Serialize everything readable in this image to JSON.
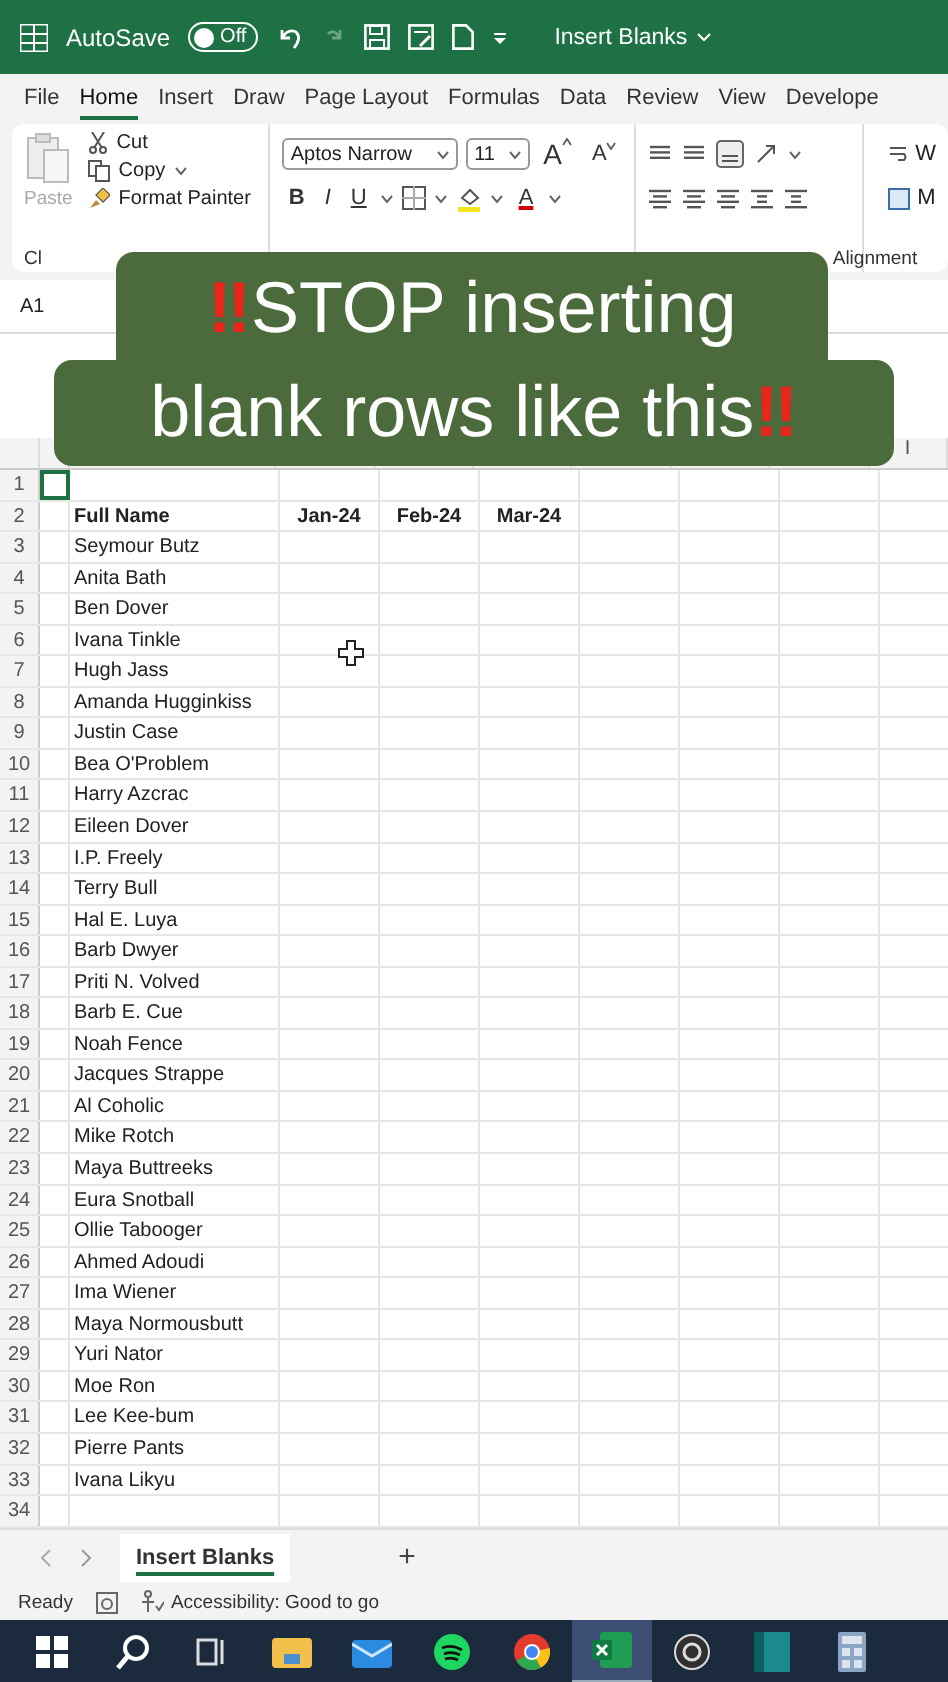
{
  "title_bar": {
    "autosave_label": "AutoSave",
    "autosave": {
      "label": "Off",
      "on": false
    },
    "document_title": "Insert Blanks"
  },
  "menu_tabs": [
    {
      "label": "File",
      "selected": false
    },
    {
      "label": "Home",
      "selected": true
    },
    {
      "label": "Insert",
      "selected": false
    },
    {
      "label": "Draw",
      "selected": false
    },
    {
      "label": "Page Layout",
      "selected": false
    },
    {
      "label": "Formulas",
      "selected": false
    },
    {
      "label": "Data",
      "selected": false
    },
    {
      "label": "Review",
      "selected": false
    },
    {
      "label": "View",
      "selected": false
    },
    {
      "label": "Develope",
      "selected": false
    }
  ],
  "ribbon": {
    "clipboard": {
      "paste": "Paste",
      "cut": "Cut",
      "copy": "Copy",
      "format_painter": "Format Painter",
      "group_label": "Cl"
    },
    "font": {
      "name": "Aptos Narrow",
      "size": "11",
      "grow": "A",
      "shrink": "A",
      "bold": "B",
      "italic": "I",
      "underline": "U",
      "font_color": "A"
    },
    "alignment": {
      "group_label": "Alignment"
    },
    "wrap_label": "W",
    "merge_label": "M"
  },
  "name_box": "A1",
  "caption": {
    "lines": [
      [
        {
          "kind": "mark",
          "text": "‼"
        },
        {
          "kind": "text",
          "text": "STOP inserting"
        }
      ],
      [
        {
          "kind": "text",
          "text": "blank rows like this"
        },
        {
          "kind": "mark",
          "text": "‼"
        }
      ]
    ]
  },
  "visible_column_header": "I",
  "rows": [
    {
      "number": "1",
      "kind": "empty",
      "selected": true
    },
    {
      "number": "2",
      "kind": "header",
      "cells": [
        "Full Name",
        "Jan-24",
        "Feb-24",
        "Mar-24"
      ],
      "selected": false
    },
    {
      "number": "3",
      "kind": "data",
      "cells": [
        "Seymour Butz"
      ],
      "selected": false
    },
    {
      "number": "4",
      "kind": "data",
      "cells": [
        "Anita Bath"
      ],
      "selected": false
    },
    {
      "number": "5",
      "kind": "data",
      "cells": [
        "Ben Dover"
      ],
      "selected": false
    },
    {
      "number": "6",
      "kind": "data",
      "cells": [
        "Ivana Tinkle"
      ],
      "selected": false
    },
    {
      "number": "7",
      "kind": "data",
      "cells": [
        "Hugh Jass"
      ],
      "selected": false
    },
    {
      "number": "8",
      "kind": "data",
      "cells": [
        "Amanda Hugginkiss"
      ],
      "selected": false
    },
    {
      "number": "9",
      "kind": "data",
      "cells": [
        "Justin Case"
      ],
      "selected": false
    },
    {
      "number": "10",
      "kind": "data",
      "cells": [
        "Bea O'Problem"
      ],
      "selected": false
    },
    {
      "number": "11",
      "kind": "data",
      "cells": [
        "Harry Azcrac"
      ],
      "selected": false
    },
    {
      "number": "12",
      "kind": "data",
      "cells": [
        "Eileen Dover"
      ],
      "selected": false
    },
    {
      "number": "13",
      "kind": "data",
      "cells": [
        "I.P. Freely"
      ],
      "selected": false
    },
    {
      "number": "14",
      "kind": "data",
      "cells": [
        "Terry Bull"
      ],
      "selected": false
    },
    {
      "number": "15",
      "kind": "data",
      "cells": [
        "Hal E. Luya"
      ],
      "selected": false
    },
    {
      "number": "16",
      "kind": "data",
      "cells": [
        "Barb Dwyer"
      ],
      "selected": false
    },
    {
      "number": "17",
      "kind": "data",
      "cells": [
        "Priti N. Volved"
      ],
      "selected": false
    },
    {
      "number": "18",
      "kind": "data",
      "cells": [
        "Barb E. Cue"
      ],
      "selected": false
    },
    {
      "number": "19",
      "kind": "data",
      "cells": [
        "Noah Fence"
      ],
      "selected": false
    },
    {
      "number": "20",
      "kind": "data",
      "cells": [
        "Jacques Strappe"
      ],
      "selected": false
    },
    {
      "number": "21",
      "kind": "data",
      "cells": [
        "Al Coholic"
      ],
      "selected": false
    },
    {
      "number": "22",
      "kind": "data",
      "cells": [
        "Mike Rotch"
      ],
      "selected": false
    },
    {
      "number": "23",
      "kind": "data",
      "cells": [
        "Maya Buttreeks"
      ],
      "selected": false
    },
    {
      "number": "24",
      "kind": "data",
      "cells": [
        "Eura Snotball"
      ],
      "selected": false
    },
    {
      "number": "25",
      "kind": "data",
      "cells": [
        "Ollie Tabooger"
      ],
      "selected": false
    },
    {
      "number": "26",
      "kind": "data",
      "cells": [
        "Ahmed Adoudi"
      ],
      "selected": false
    },
    {
      "number": "27",
      "kind": "data",
      "cells": [
        "Ima Wiener"
      ],
      "selected": false
    },
    {
      "number": "28",
      "kind": "data",
      "cells": [
        "Maya Normousbutt"
      ],
      "selected": false
    },
    {
      "number": "29",
      "kind": "data",
      "cells": [
        "Yuri Nator"
      ],
      "selected": false
    },
    {
      "number": "30",
      "kind": "data",
      "cells": [
        "Moe Ron"
      ],
      "selected": false
    },
    {
      "number": "31",
      "kind": "data",
      "cells": [
        "Lee Kee-bum"
      ],
      "selected": false
    },
    {
      "number": "32",
      "kind": "data",
      "cells": [
        "Pierre Pants"
      ],
      "selected": false
    },
    {
      "number": "33",
      "kind": "data",
      "cells": [
        "Ivana Likyu"
      ],
      "selected": false
    },
    {
      "number": "34",
      "kind": "empty",
      "selected": false
    }
  ],
  "sheet_tabs": [
    {
      "label": "Insert Blanks",
      "selected": true
    }
  ],
  "add_sheet": "+",
  "status_bar": {
    "status": "Ready",
    "accessibility": "Accessibility: Good to go"
  },
  "taskbar": [
    {
      "kind": "windows",
      "active": false
    },
    {
      "kind": "search",
      "active": false
    },
    {
      "kind": "task-view",
      "active": false
    },
    {
      "kind": "folder",
      "active": false
    },
    {
      "kind": "mail",
      "active": false
    },
    {
      "kind": "music",
      "active": false
    },
    {
      "kind": "browser",
      "active": false
    },
    {
      "kind": "spreadsheet",
      "active": true
    },
    {
      "kind": "recorder",
      "active": false
    },
    {
      "kind": "notebook",
      "active": false
    },
    {
      "kind": "calculator",
      "active": false
    }
  ]
}
